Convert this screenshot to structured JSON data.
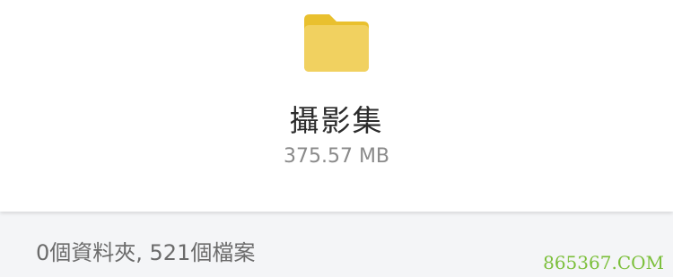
{
  "folder": {
    "icon": "folder-icon",
    "name": "攝影集",
    "size": "375.57 MB",
    "color": "#f1d160",
    "tab_color": "#e9c02e"
  },
  "summary": {
    "text": "0個資料夾, 521個檔案"
  },
  "watermark": {
    "text": "865367.COM",
    "color": "#7bbf3a"
  }
}
